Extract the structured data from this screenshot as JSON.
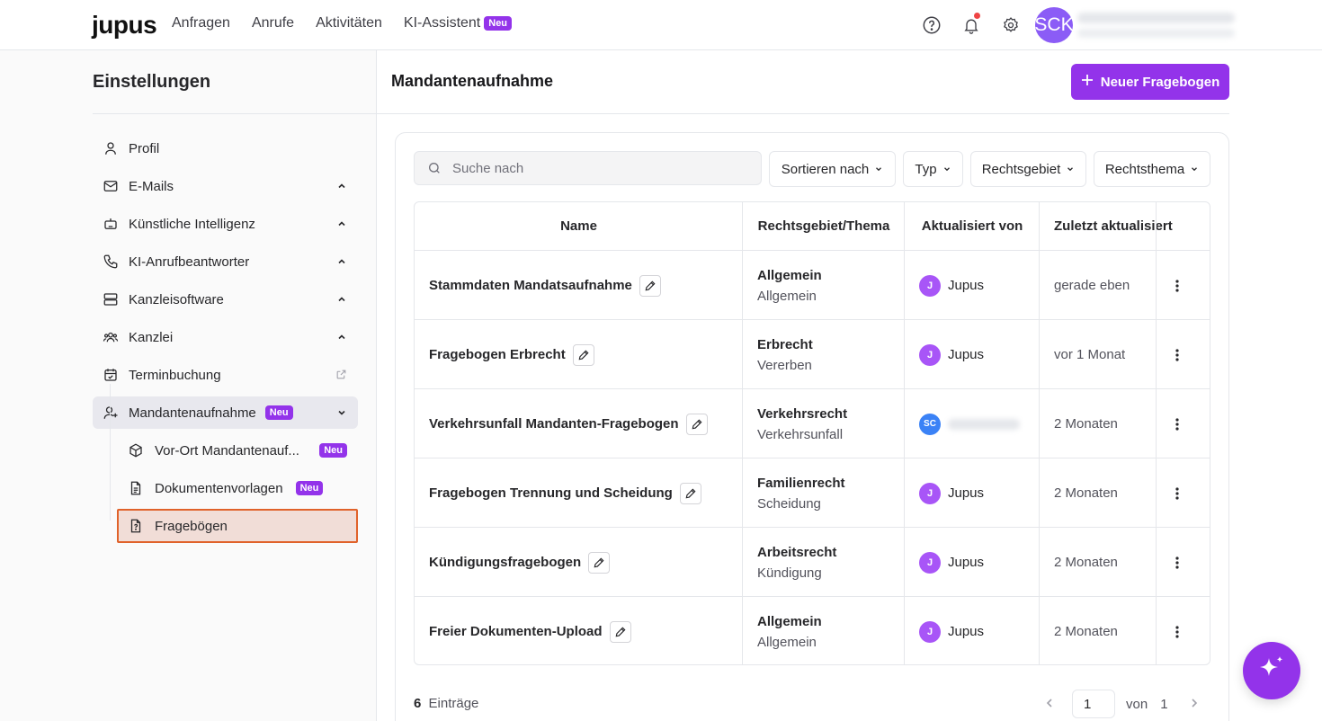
{
  "app": {
    "logo": "jupus",
    "nav": [
      {
        "label": "Anfragen"
      },
      {
        "label": "Anrufe"
      },
      {
        "label": "Aktivitäten"
      },
      {
        "label": "KI-Assistent",
        "badge": "Neu"
      }
    ],
    "user_initials": "SCK",
    "accent_color": "#9333ea"
  },
  "sidebar": {
    "title": "Einstellungen",
    "items": [
      {
        "label": "Profil",
        "icon": "user-icon"
      },
      {
        "label": "E-Mails",
        "icon": "mail-icon",
        "expandable": true
      },
      {
        "label": "Künstliche Intelligenz",
        "icon": "robot-icon",
        "expandable": true
      },
      {
        "label": "KI-Anrufbeantworter",
        "icon": "phone-icon",
        "expandable": true
      },
      {
        "label": "Kanzleisoftware",
        "icon": "server-icon",
        "expandable": true
      },
      {
        "label": "Kanzlei",
        "icon": "team-icon",
        "expandable": true
      },
      {
        "label": "Terminbuchung",
        "icon": "calendar-check-icon",
        "external": true
      },
      {
        "label": "Mandantenaufnahme",
        "icon": "user-plus-icon",
        "badge": "Neu",
        "expanded": true
      }
    ],
    "subitems": [
      {
        "label": "Vor-Ort Mandantenauf...",
        "icon": "box-icon",
        "badge": "Neu"
      },
      {
        "label": "Dokumentenvorlagen",
        "icon": "document-icon",
        "badge": "Neu"
      },
      {
        "label": "Fragebögen",
        "icon": "question-file-icon",
        "selected": true
      }
    ]
  },
  "main": {
    "title": "Mandantenaufnahme",
    "new_button": "Neuer Fragebogen",
    "search_placeholder": "Suche nach",
    "filters": [
      "Sortieren nach",
      "Typ",
      "Rechtsgebiet",
      "Rechtsthema"
    ],
    "columns": [
      "Name",
      "Rechtsgebiet/Thema",
      "Aktualisiert von",
      "Zuletzt aktualisiert"
    ],
    "rows": [
      {
        "name": "Stammdaten Mandatsaufnahme",
        "area": "Allgemein",
        "topic": "Allgemein",
        "user_initial": "J",
        "user": "Jupus",
        "updated": "gerade eben"
      },
      {
        "name": "Fragebogen Erbrecht",
        "area": "Erbrecht",
        "topic": "Vererben",
        "user_initial": "J",
        "user": "Jupus",
        "updated": "vor 1 Monat"
      },
      {
        "name": "Verkehrsunfall Mandanten-Fragebogen",
        "area": "Verkehrsrecht",
        "topic": "Verkehrsunfall",
        "user_initial": "SC",
        "user": "",
        "updated": "2 Monaten"
      },
      {
        "name": "Fragebogen Trennung und Scheidung",
        "area": "Familienrecht",
        "topic": "Scheidung",
        "user_initial": "J",
        "user": "Jupus",
        "updated": "2 Monaten"
      },
      {
        "name": "Kündigungsfragebogen",
        "area": "Arbeitsrecht",
        "topic": "Kündigung",
        "user_initial": "J",
        "user": "Jupus",
        "updated": "2 Monaten"
      },
      {
        "name": "Freier Dokumenten-Upload",
        "area": "Allgemein",
        "topic": "Allgemein",
        "user_initial": "J",
        "user": "Jupus",
        "updated": "2 Monaten"
      }
    ],
    "footer": {
      "count": "6",
      "count_label": "Einträge",
      "page": "1",
      "of_label": "von",
      "total_pages": "1"
    }
  }
}
